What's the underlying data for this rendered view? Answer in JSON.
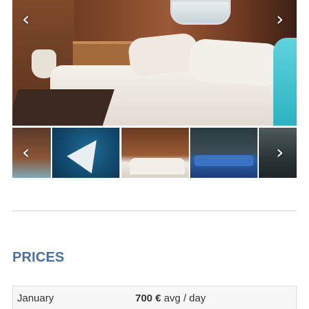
{
  "gallery": {
    "main_photo_icon": "cabin-bedroom-photo",
    "prev_arrow": "‹",
    "next_arrow": "›",
    "thumbnails": [
      {
        "icon": "bathroom-photo"
      },
      {
        "icon": "sailboat-aerial-photo"
      },
      {
        "icon": "cabin-bed-photo"
      },
      {
        "icon": "deck-lounge-photo"
      },
      {
        "icon": "boat-exterior-photo"
      }
    ]
  },
  "prices": {
    "title": "PRICES",
    "rows": [
      {
        "month": "January",
        "amount": "700 €",
        "unit": " avg / day"
      }
    ]
  },
  "colors": {
    "section_title": "#4a6fa5",
    "row_background": "#f7f7f7",
    "divider": "#e6e6e6"
  }
}
